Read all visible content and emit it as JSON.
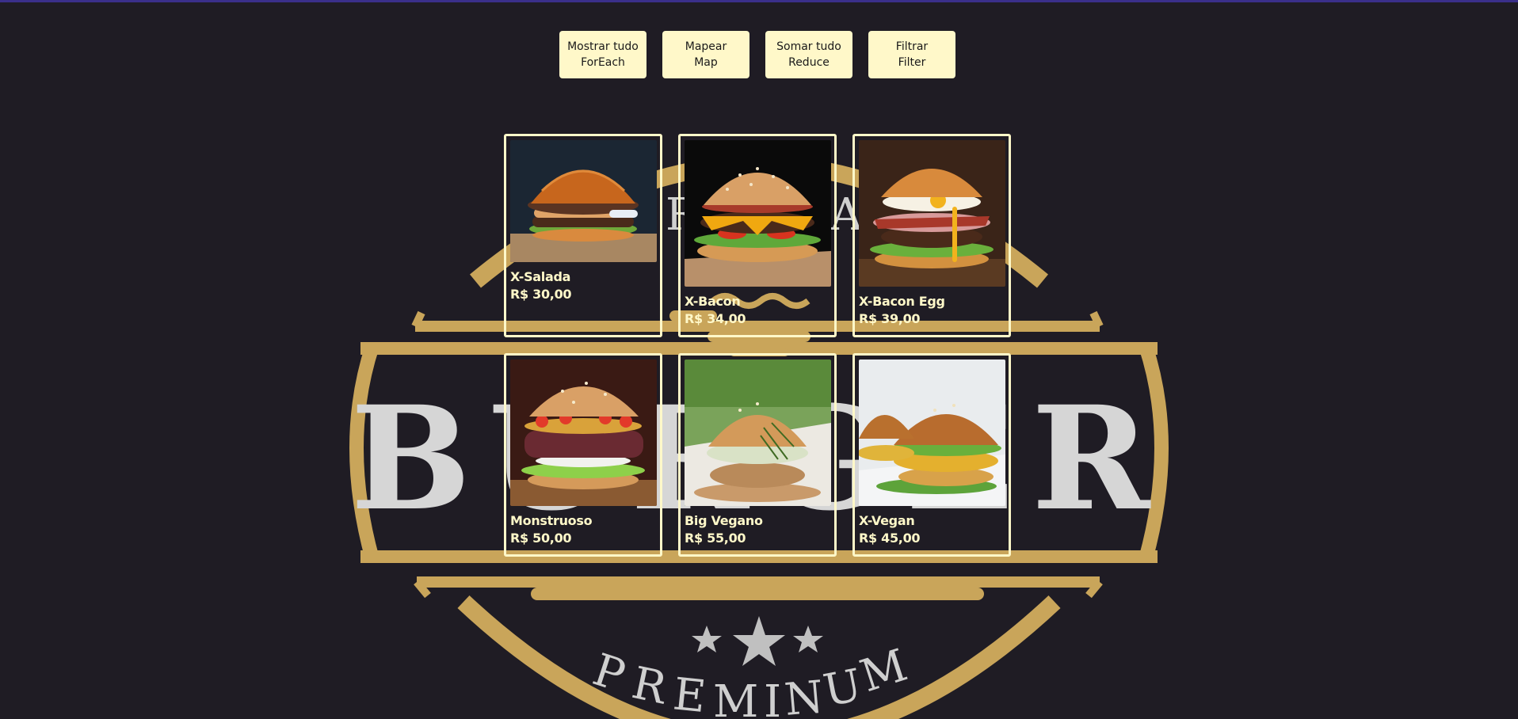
{
  "colors": {
    "background": "#1f1c24",
    "accent": "#fff8c9",
    "logo_gold": "#c9a55a",
    "logo_text": "#d9d9d9"
  },
  "background_logo": {
    "word": "BURGER",
    "tagline": "PREMINUM",
    "top_arc_text": "RA"
  },
  "buttons": [
    {
      "line1": "Mostrar tudo",
      "line2": "ForEach"
    },
    {
      "line1": "Mapear",
      "line2": "Map"
    },
    {
      "line1": "Somar tudo",
      "line2": "Reduce"
    },
    {
      "line1": "Filtrar",
      "line2": "Filter"
    }
  ],
  "products": [
    {
      "name": "X-Salada",
      "price": "R$ 30,00",
      "image": "burger-salad-photo"
    },
    {
      "name": "X-Bacon",
      "price": "R$ 34,00",
      "image": "burger-bacon-photo"
    },
    {
      "name": "X-Bacon Egg",
      "price": "R$ 39,00",
      "image": "burger-bacon-egg-photo"
    },
    {
      "name": "Monstruoso",
      "price": "R$ 50,00",
      "image": "burger-monster-photo"
    },
    {
      "name": "Big Vegano",
      "price": "R$ 55,00",
      "image": "burger-vegan-big-photo"
    },
    {
      "name": "X-Vegan",
      "price": "R$ 45,00",
      "image": "burger-vegan-photo"
    }
  ]
}
